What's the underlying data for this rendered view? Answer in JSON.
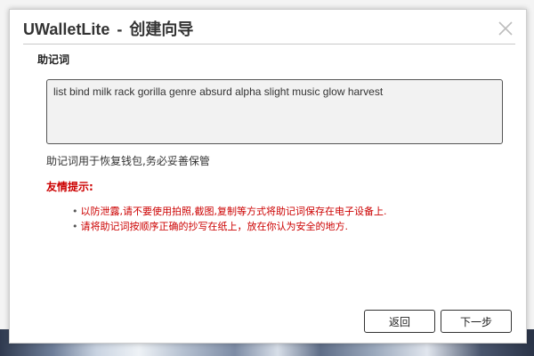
{
  "dialog": {
    "app_name": "UWalletLite",
    "separator": "-",
    "title": "创建向导",
    "close_icon": "close-icon"
  },
  "mnemonic": {
    "label": "助记词",
    "words": "list bind milk rack gorilla genre absurd alpha slight music glow harvest",
    "note": "助记词用于恢复钱包,务必妥善保管"
  },
  "tips": {
    "title": "友情提示:",
    "items": [
      "以防泄露,请不要使用拍照,截图,复制等方式将助记词保存在电子设备上.",
      "请将助记词按顺序正确的抄写在纸上，放在你认为安全的地方."
    ]
  },
  "buttons": {
    "back": "返回",
    "next": "下一步"
  },
  "colors": {
    "warning_red": "#cc0000",
    "text": "#333333",
    "box_bg": "#f2f2f2"
  }
}
